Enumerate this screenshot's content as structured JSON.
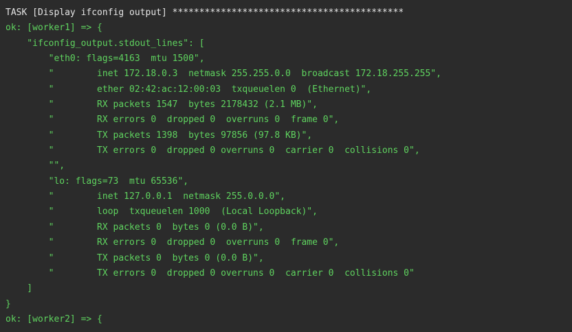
{
  "terminal": {
    "lines": [
      {
        "text": "TASK [Display ifconfig output] *******************************************",
        "color": "#e6e6e6"
      },
      {
        "text": "ok: [worker1] => {",
        "color": "#5fd35f"
      },
      {
        "text": "    \"ifconfig_output.stdout_lines\": [",
        "color": "#5fd35f"
      },
      {
        "text": "        \"eth0: flags=4163  mtu 1500\",",
        "color": "#5fd35f"
      },
      {
        "text": "        \"        inet 172.18.0.3  netmask 255.255.0.0  broadcast 172.18.255.255\",",
        "color": "#5fd35f"
      },
      {
        "text": "        \"        ether 02:42:ac:12:00:03  txqueuelen 0  (Ethernet)\",",
        "color": "#5fd35f"
      },
      {
        "text": "        \"        RX packets 1547  bytes 2178432 (2.1 MB)\",",
        "color": "#5fd35f"
      },
      {
        "text": "        \"        RX errors 0  dropped 0  overruns 0  frame 0\",",
        "color": "#5fd35f"
      },
      {
        "text": "        \"        TX packets 1398  bytes 97856 (97.8 KB)\",",
        "color": "#5fd35f"
      },
      {
        "text": "        \"        TX errors 0  dropped 0 overruns 0  carrier 0  collisions 0\",",
        "color": "#5fd35f"
      },
      {
        "text": "        \"\",",
        "color": "#5fd35f"
      },
      {
        "text": "        \"lo: flags=73  mtu 65536\",",
        "color": "#5fd35f"
      },
      {
        "text": "        \"        inet 127.0.0.1  netmask 255.0.0.0\",",
        "color": "#5fd35f"
      },
      {
        "text": "        \"        loop  txqueuelen 1000  (Local Loopback)\",",
        "color": "#5fd35f"
      },
      {
        "text": "        \"        RX packets 0  bytes 0 (0.0 B)\",",
        "color": "#5fd35f"
      },
      {
        "text": "        \"        RX errors 0  dropped 0  overruns 0  frame 0\",",
        "color": "#5fd35f"
      },
      {
        "text": "        \"        TX packets 0  bytes 0 (0.0 B)\",",
        "color": "#5fd35f"
      },
      {
        "text": "        \"        TX errors 0  dropped 0 overruns 0  carrier 0  collisions 0\"",
        "color": "#5fd35f"
      },
      {
        "text": "    ]",
        "color": "#5fd35f"
      },
      {
        "text": "}",
        "color": "#5fd35f"
      },
      {
        "text": "ok: [worker2] => {",
        "color": "#5fd35f"
      }
    ]
  }
}
